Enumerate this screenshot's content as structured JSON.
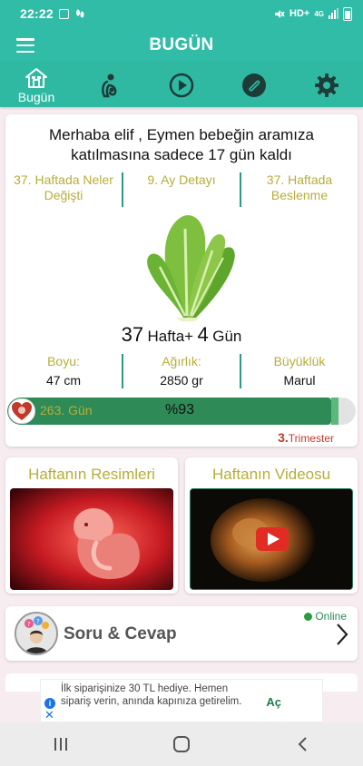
{
  "status_bar": {
    "time": "22:22",
    "network": "HD+",
    "network_gen": "4G",
    "battery_level": 0.7
  },
  "header": {
    "title": "BUGÜN",
    "menu_icon": "hamburger-icon"
  },
  "tabs": [
    {
      "label": "Bugün",
      "icon": "home-icon",
      "active": true
    },
    {
      "icon": "mother-baby-icon",
      "active": false
    },
    {
      "icon": "play-icon",
      "active": false
    },
    {
      "icon": "paperclip-icon",
      "active": false
    },
    {
      "icon": "gear-icon",
      "active": false
    }
  ],
  "main": {
    "greeting": "Merhaba elif , Eymen bebeğin aramıza katılmasına sadece 17 gün kaldı",
    "links": [
      "37. Haftada Neler Değişti",
      "9. Ay Detayı",
      "37. Haftada Beslenme"
    ],
    "fruit_icon": "lettuce-image",
    "weeks_number": "37",
    "weeks_label": "Hafta+",
    "days_number": "4",
    "days_label": "Gün",
    "stats": [
      {
        "label": "Boyu:",
        "value": "47 cm"
      },
      {
        "label": "Ağırlık:",
        "value": "2850 gr"
      },
      {
        "label": "Büyüklük",
        "value": "Marul"
      }
    ],
    "progress": {
      "days_text": "263. Gün",
      "percent_text": "%93",
      "fraction": 0.93
    },
    "trimester_number": "3.",
    "trimester_label": "Trimester"
  },
  "media": {
    "pictures_title": "Haftanın Resimleri",
    "video_title": "Haftanın Videosu"
  },
  "qa": {
    "title": "Soru & Cevap",
    "online_label": "Online"
  },
  "ad": {
    "text": "İlk siparişinize 30 TL hediye. Hemen sipariş verin, anında kapınıza getirelim.",
    "cta": "Aç"
  },
  "colors": {
    "brand": "#30bca6",
    "accent_text": "#b7ad3a",
    "progress": "#2e8b57",
    "trimester": "#c0392b"
  }
}
